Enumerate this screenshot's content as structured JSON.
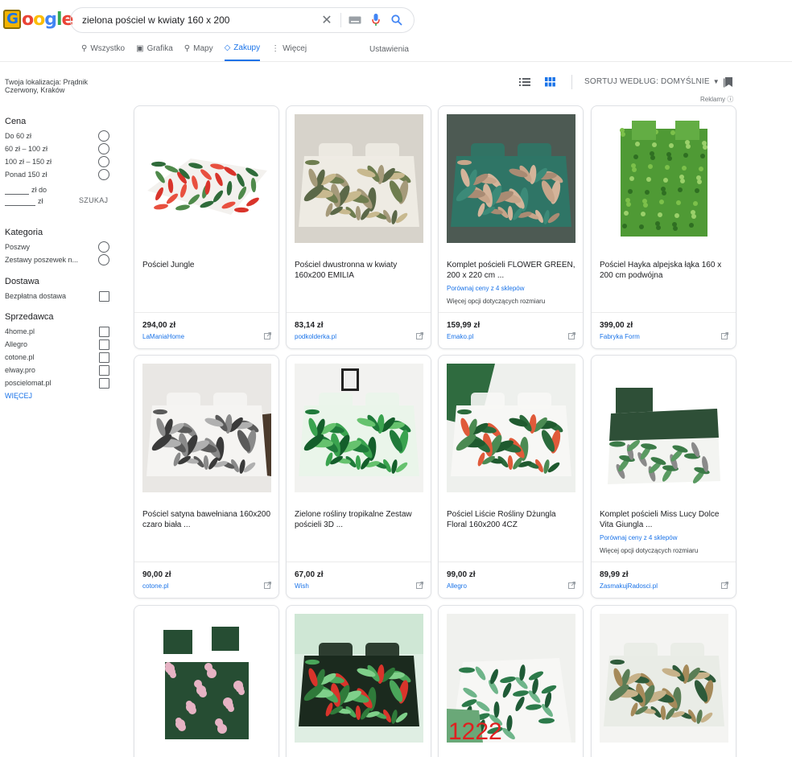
{
  "logo": {
    "text": "Google"
  },
  "search": {
    "query": "zielona pościel w kwiaty 160 x 200"
  },
  "tabs": [
    {
      "label": "Wszystko",
      "icon": "search-icon"
    },
    {
      "label": "Grafika",
      "icon": "image-icon"
    },
    {
      "label": "Mapy",
      "icon": "map-pin-icon"
    },
    {
      "label": "Zakupy",
      "icon": "tag-icon",
      "active": true
    },
    {
      "label": "Więcej",
      "icon": "more-vert-icon"
    }
  ],
  "settings_label": "Ustawienia",
  "location": {
    "text": "Twoja lokalizacja: Prądnik Czerwony, Kraków"
  },
  "filters": {
    "price": {
      "title": "Cena",
      "options": [
        "Do 60 zł",
        "60 zł – 100 zł",
        "100 zł – 150 zł",
        "Ponad 150 zł"
      ],
      "from_label": "zł do",
      "to_label": "zł",
      "submit": "SZUKAJ"
    },
    "category": {
      "title": "Kategoria",
      "options": [
        "Poszwy",
        "Zestawy poszewek n..."
      ]
    },
    "delivery": {
      "title": "Dostawa",
      "options": [
        "Bezpłatna dostawa"
      ]
    },
    "seller": {
      "title": "Sprzedawca",
      "options": [
        "4home.pl",
        "Allegro",
        "cotone.pl",
        "elway.pro",
        "poscielomat.pl"
      ],
      "more": "WIĘCEJ"
    }
  },
  "toolbar": {
    "sort_label": "SORTUJ WEDŁUG: DOMYŚLNIE",
    "ads_label": "Reklamy ⓘ"
  },
  "products": [
    {
      "title": "Pościel Jungle",
      "price": "294,00 zł",
      "store": "LaManiaHome"
    },
    {
      "title": "Pościel dwustronna w kwiaty 160x200 EMILIA",
      "price": "83,14 zł",
      "store": "podkolderka.pl"
    },
    {
      "title": "Komplet pościeli FLOWER GREEN, 200 x 220 cm ...",
      "price": "159,99 zł",
      "store": "Emako.pl",
      "compare": "Porównaj ceny z 4 sklepów",
      "more": "Więcej opcji dotyczących rozmiaru"
    },
    {
      "title": "Pościel Hayka alpejska łąka 160 x 200 cm podwójna",
      "price": "399,00 zł",
      "store": "Fabryka Form"
    },
    {
      "title": "Pościel satyna bawełniana 160x200 czaro biała ...",
      "price": "90,00 zł",
      "store": "cotone.pl"
    },
    {
      "title": "Zielone rośliny tropikalne Zestaw pościeli 3D ...",
      "price": "67,00 zł",
      "store": "Wish"
    },
    {
      "title": "Pościel Liście Rośliny Dżungla Floral 160x200 4CZ",
      "price": "99,00 zł",
      "store": "Allegro"
    },
    {
      "title": "Komplet pościeli Miss Lucy Dolce Vita Giungla ...",
      "price": "89,99 zł",
      "store": "ZasmakujRadosci.pl",
      "compare": "Porównaj ceny z 4 sklepów",
      "more": "Więcej opcji dotyczących rozmiaru"
    },
    {
      "title": "",
      "price": "",
      "store": ""
    },
    {
      "title": "",
      "price": "",
      "store": ""
    },
    {
      "title": "",
      "price": "",
      "store": "",
      "image_text": "1222"
    },
    {
      "title": "",
      "price": "",
      "store": ""
    }
  ]
}
